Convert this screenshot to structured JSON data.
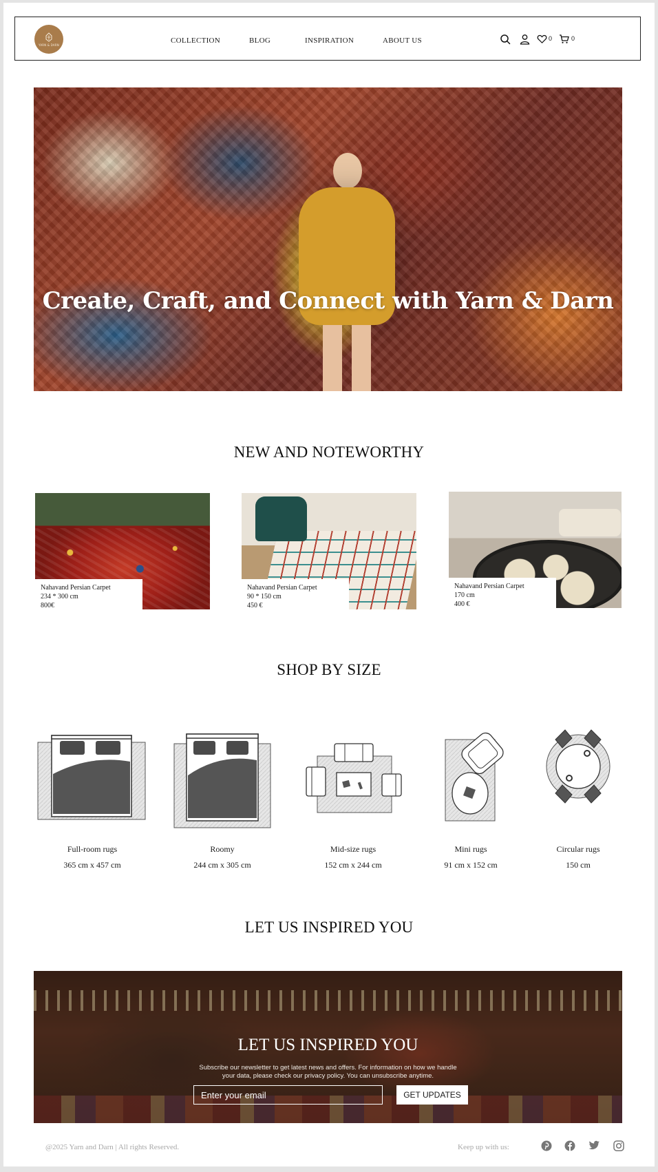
{
  "brand": {
    "logo_text": "YARN & DARN"
  },
  "nav": {
    "items": [
      {
        "label": "COLLECTION"
      },
      {
        "label": "BLOG"
      },
      {
        "label": "INSPIRATION"
      },
      {
        "label": "ABOUT US"
      }
    ],
    "wishlist_count": "0",
    "cart_count": "0",
    "icons": [
      "search-icon",
      "user-icon",
      "heart-icon",
      "cart-icon"
    ]
  },
  "hero": {
    "title": "Create, Craft, and Connect with Yarn & Darn"
  },
  "new_section": {
    "title": "NEW AND NOTEWORTHY",
    "products": [
      {
        "name": "Nahavand Persian Carpet",
        "size": "234 * 300 cm",
        "price": "800€"
      },
      {
        "name": "Nahavand Persian Carpet",
        "size": "90 * 150 cm",
        "price": "450 €"
      },
      {
        "name": "Nahavand Persian Carpet",
        "size": "170 cm",
        "price": "400 €"
      }
    ]
  },
  "size_section": {
    "title": "SHOP BY SIZE",
    "items": [
      {
        "label": "Full-room rugs",
        "dims": "365 cm x 457 cm"
      },
      {
        "label": "Roomy",
        "dims": "244 cm x 305 cm"
      },
      {
        "label": "Mid-size rugs",
        "dims": "152 cm x 244 cm"
      },
      {
        "label": "Mini rugs",
        "dims": "91 cm x 152 cm"
      },
      {
        "label": "Circular rugs",
        "dims": "150 cm"
      }
    ]
  },
  "inspire_section": {
    "title": "LET US INSPIRED YOU"
  },
  "newsletter": {
    "title": "LET US INSPIRED YOU",
    "text": "Subscribe our newsletter to get latest news and offers. For information on how we handle your data, please check our privacy policy. You can unsubscribe anytime.",
    "placeholder": "Enter your email",
    "button": "GET UPDATES"
  },
  "footer": {
    "copyright": "@2025 Yarn and Darn | All rights Reserved.",
    "keep_up": "Keep up with us:",
    "social": [
      "pinterest-icon",
      "facebook-icon",
      "twitter-icon",
      "instagram-icon"
    ]
  },
  "colors": {
    "logo": "#a97c4b",
    "text": "#1a1a1a",
    "muted": "#a8a8a8"
  }
}
